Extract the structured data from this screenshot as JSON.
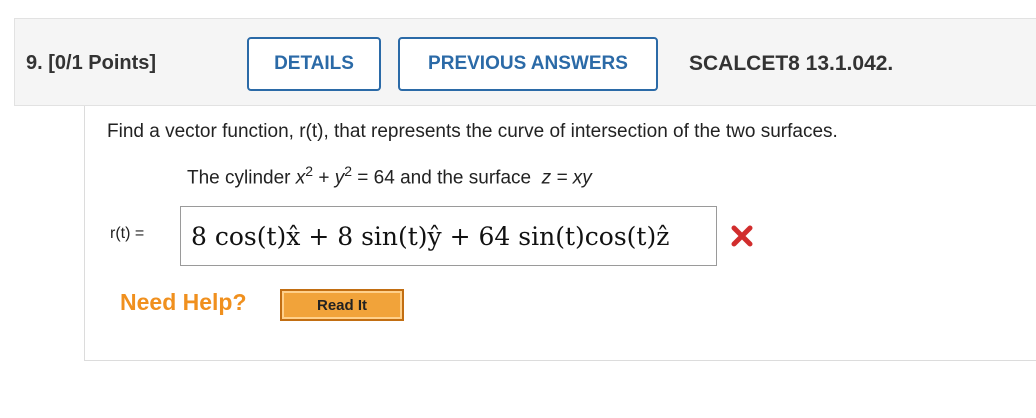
{
  "question": {
    "number_points": "9.  [0/1 Points]",
    "code": "SCALCET8 13.1.042."
  },
  "buttons": {
    "details": "DETAILS",
    "previous_answers": "PREVIOUS ANSWERS",
    "read_it": "Read It"
  },
  "prompt": "Find a vector function, r(t), that represents the curve of intersection of the two surfaces.",
  "surfaces": {
    "lead": "The cylinder ",
    "rhs": " = 64  and the surface ",
    "z_eq": "z = xy"
  },
  "answer": {
    "label": "r(t) =",
    "value": "8 cos(t)x̂ + 8 sin(t)ŷ + 64 sin(t)cos(t)ẑ",
    "status": "incorrect"
  },
  "help": {
    "label": "Need Help?"
  },
  "colors": {
    "accent": "#2b6aa7",
    "incorrect": "#d12d2d",
    "help_orange": "#f0901e"
  }
}
